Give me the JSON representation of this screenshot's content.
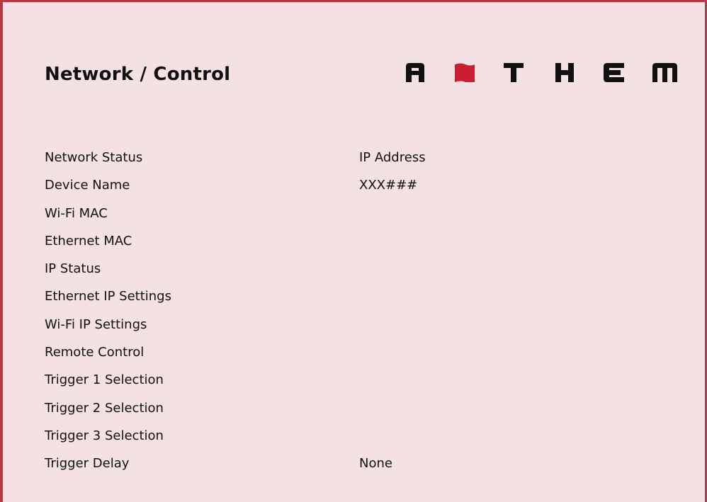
{
  "header": {
    "title": "Network / Control",
    "logo_text": "ANTHEM",
    "logo_color": "#111111",
    "logo_flag_color": "#c8202f"
  },
  "theme": {
    "background": "#f3e1e3",
    "border": "#b23a44"
  },
  "settings": [
    {
      "label": "Network Status",
      "value": "IP Address"
    },
    {
      "label": "Device Name",
      "value": "XXX###"
    },
    {
      "label": "Wi-Fi MAC",
      "value": ""
    },
    {
      "label": "Ethernet MAC",
      "value": ""
    },
    {
      "label": "IP Status",
      "value": ""
    },
    {
      "label": "Ethernet IP Settings",
      "value": ""
    },
    {
      "label": "Wi-Fi IP Settings",
      "value": ""
    },
    {
      "label": "Remote Control",
      "value": ""
    },
    {
      "label": "Trigger 1 Selection",
      "value": ""
    },
    {
      "label": "Trigger 2 Selection",
      "value": ""
    },
    {
      "label": "Trigger 3 Selection",
      "value": ""
    },
    {
      "label": "Trigger Delay",
      "value": "None"
    }
  ]
}
